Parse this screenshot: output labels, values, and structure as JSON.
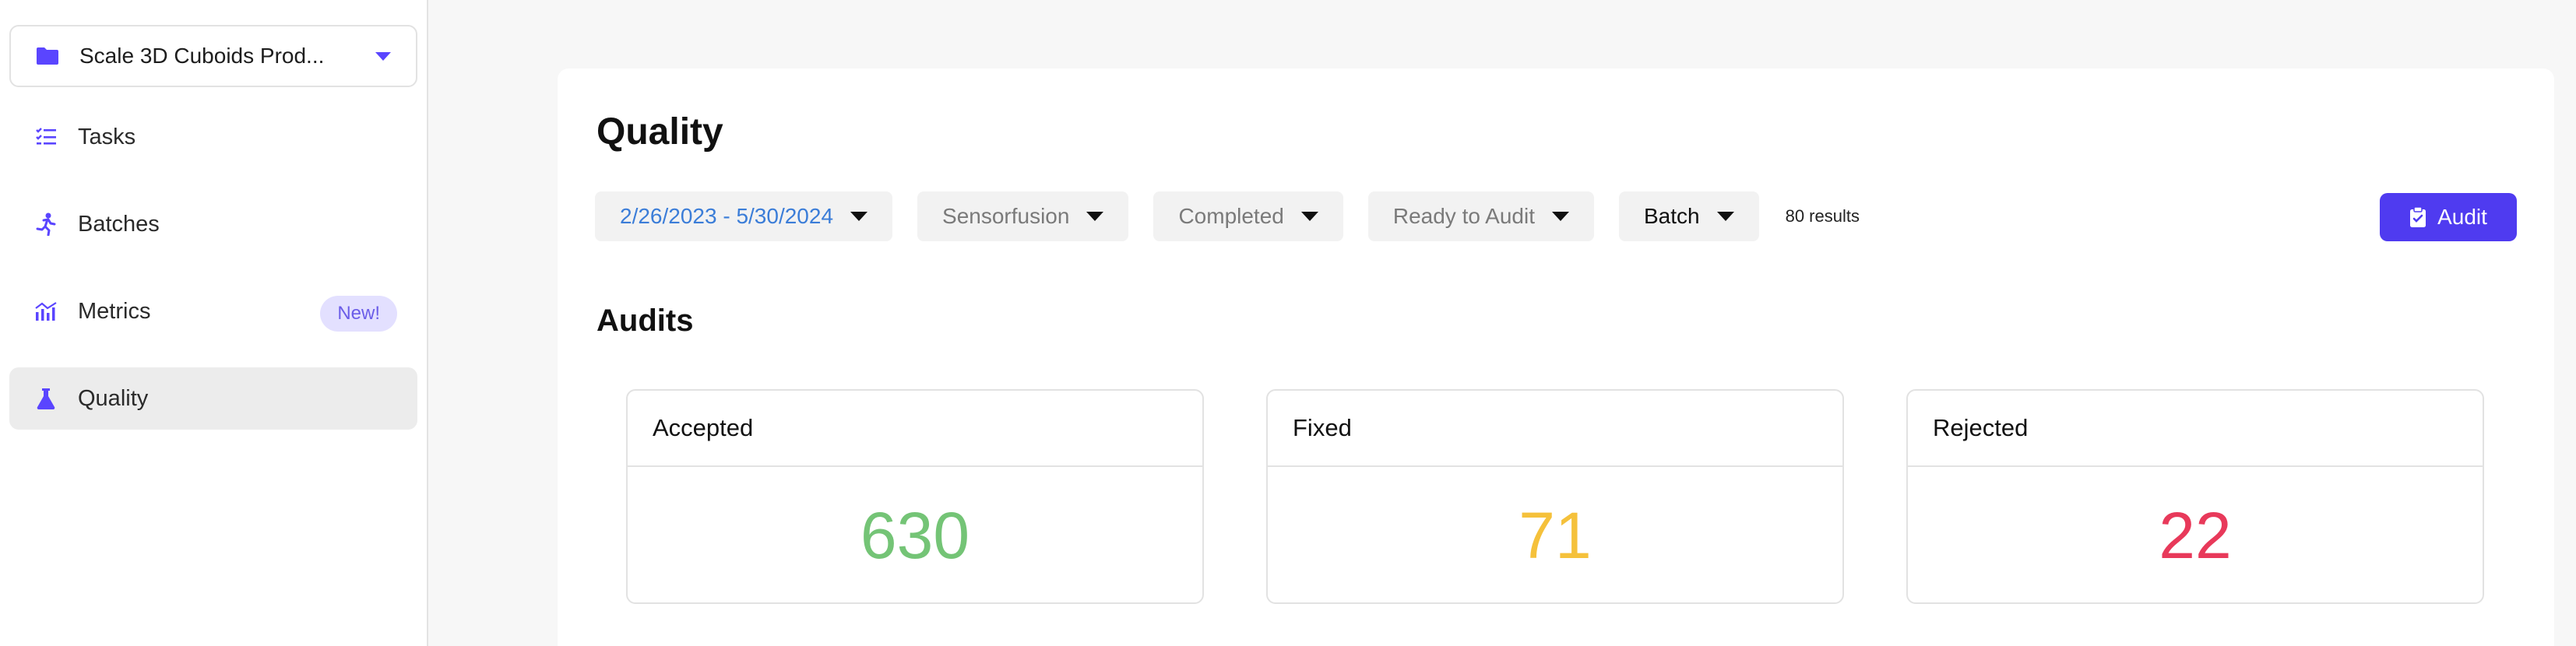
{
  "sidebar": {
    "project": {
      "label": "Scale 3D Cuboids Prod...",
      "icon": "folder-icon"
    },
    "items": [
      {
        "label": "Tasks",
        "icon": "tasks-list-icon"
      },
      {
        "label": "Batches",
        "icon": "running-person-icon"
      },
      {
        "label": "Metrics",
        "icon": "chart-icon",
        "badge": "New!"
      },
      {
        "label": "Quality",
        "icon": "flask-icon",
        "active": true
      }
    ]
  },
  "main": {
    "title": "Quality",
    "filters": [
      {
        "label": "2/26/2023 - 5/30/2024"
      },
      {
        "label": "Sensorfusion"
      },
      {
        "label": "Completed"
      },
      {
        "label": "Ready to Audit"
      },
      {
        "label": "Batch"
      }
    ],
    "results": "80 results",
    "audit_button": "Audit",
    "section_title": "Audits",
    "stats": [
      {
        "label": "Accepted",
        "value": "630",
        "color": "#74c476"
      },
      {
        "label": "Fixed",
        "value": "71",
        "color": "#f5c13b"
      },
      {
        "label": "Rejected",
        "value": "22",
        "color": "#e8395a"
      }
    ]
  },
  "colors": {
    "accent": "#4f3bf0",
    "icon": "#5a45ff",
    "date": "#3b7dd8"
  }
}
